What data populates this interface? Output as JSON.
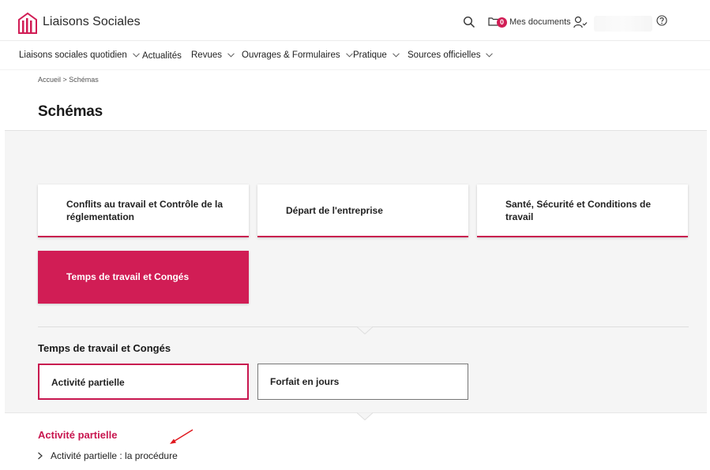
{
  "header": {
    "brand": "Liaisons Sociales",
    "docs_count": "0",
    "docs_label": "Mes documents",
    "icons": [
      "search-icon",
      "folder-icon",
      "user-check-icon",
      "help-icon"
    ],
    "accent": "#d11d55"
  },
  "nav": {
    "items": [
      {
        "label": "Liaisons sociales quotidien",
        "dropdown": true
      },
      {
        "label": "Actualités",
        "dropdown": false
      },
      {
        "label": "Revues",
        "dropdown": true
      },
      {
        "label": "Ouvrages & Formulaires",
        "dropdown": true
      },
      {
        "label": "Pratique",
        "dropdown": true
      },
      {
        "label": "Sources officielles",
        "dropdown": true
      }
    ]
  },
  "breadcrumb": "Accueil > Schémas",
  "page_title": "Schémas",
  "categories": [
    {
      "label": "Conflits au travail et Contrôle de la réglementation",
      "active": false
    },
    {
      "label": "Départ de l'entreprise",
      "active": false
    },
    {
      "label": "Santé, Sécurité et Conditions de travail",
      "active": false
    },
    {
      "label": "Temps de travail et Congés",
      "active": true
    }
  ],
  "section": {
    "title": "Temps de travail et Congés",
    "items": [
      {
        "label": "Activité partielle",
        "selected": true
      },
      {
        "label": "Forfait en jours",
        "selected": false
      }
    ]
  },
  "detail": {
    "title": "Activité partielle",
    "links": [
      "Activité partielle : la procédure"
    ]
  }
}
